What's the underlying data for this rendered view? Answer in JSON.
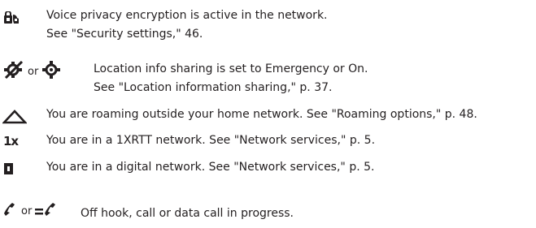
{
  "entries": [
    {
      "icon": "voice-privacy-encryption-icon",
      "lines": [
        "Voice privacy encryption is active in the network.",
        "See \"Security settings,\" 46."
      ]
    },
    {
      "icons": [
        "location-sharing-emergency-icon",
        "location-sharing-on-icon"
      ],
      "connector": "or",
      "lines": [
        "Location info sharing is set to Emergency or On.",
        "See \"Location information sharing,\" p. 37."
      ]
    },
    {
      "icon": "roaming-triangle-icon",
      "lines": [
        "You are roaming outside your home network. See \"Roaming options,\" p. 48."
      ]
    },
    {
      "icon": "1xrtt-network-icon",
      "icon_text": "1x",
      "lines": [
        "You are in a 1XRTT network. See \"Network services,\" p. 5."
      ]
    },
    {
      "icon": "digital-network-icon",
      "icon_text": "D",
      "lines": [
        "You are in a digital network. See \"Network services,\" p. 5."
      ]
    },
    {
      "icons": [
        "off-hook-handset-icon",
        "data-call-handset-icon"
      ],
      "connector": "or",
      "lines": [
        "Off hook, call or data call in progress."
      ]
    }
  ]
}
